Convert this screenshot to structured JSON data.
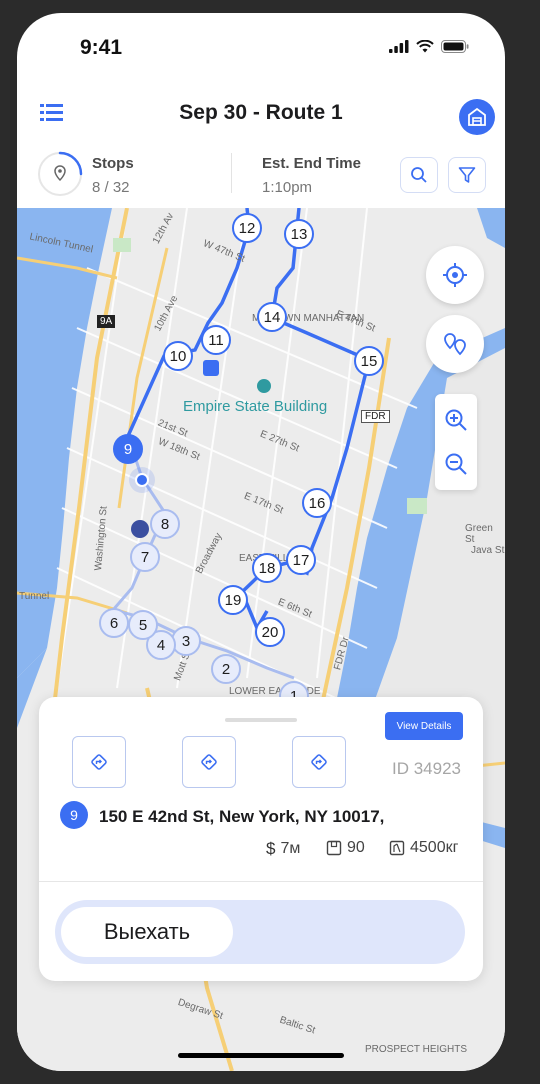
{
  "status": {
    "time": "9:41"
  },
  "header": {
    "title": "Sep 30 - Route 1"
  },
  "stats": {
    "stops_label": "Stops",
    "stops_value": "8 / 32",
    "stops_progress": 0.25,
    "end_label": "Est. End Time",
    "end_value": "1:10pm"
  },
  "map": {
    "landmark": "Empire State Building",
    "labels": [
      "Lincoln Tunnel",
      "12th Av",
      "W 47th St",
      "10th Ave",
      "MIDTOWN MANHATTAN",
      "E 47th St",
      "21st St",
      "W 18th St",
      "E 27th St",
      "E 17th St",
      "Washington St",
      "Broadway",
      "EAST VILLAGE",
      "E 6th St",
      "Mott St",
      "LOWER EAST SIDE",
      "FDR Dr",
      "FDR",
      "9A",
      "Green St",
      "Java St",
      "Tunnel",
      "Degraw St",
      "Baltic St",
      "PROSPECT HEIGHTS"
    ],
    "stops": [
      "1",
      "2",
      "3",
      "4",
      "5",
      "6",
      "7",
      "8",
      "9",
      "10",
      "11",
      "12",
      "13",
      "14",
      "15",
      "16",
      "17",
      "18",
      "19",
      "20"
    ],
    "current_stop": "9",
    "accent": "#3b6ef2"
  },
  "card": {
    "view_details": "View Details",
    "id_text": "ID 34923",
    "stop_number": "9",
    "address": "150 E 42nd St, New York, NY 10017,",
    "price": "7м",
    "packages": "90",
    "weight": "4500кг",
    "slide_label": "Выехать"
  }
}
